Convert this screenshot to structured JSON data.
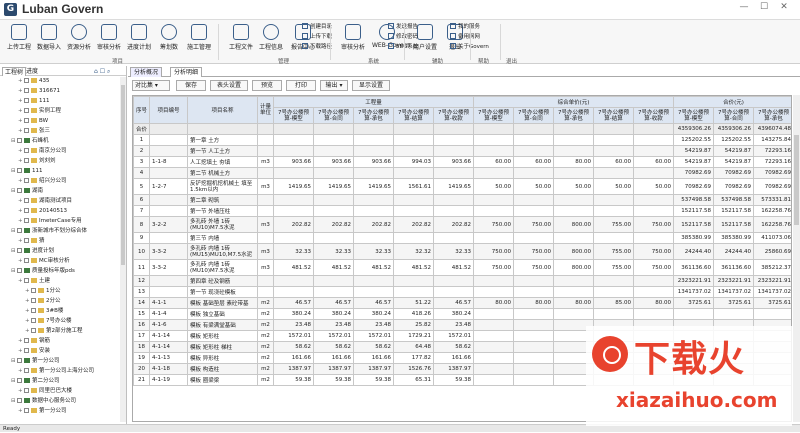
{
  "app": {
    "title": "Luban Govern",
    "logo_letter": "G"
  },
  "ribbon": {
    "buttons": [
      "上传工程",
      "数据导入",
      "资源分析",
      "审核分析",
      "进度计划",
      "筹划数",
      "施工管理",
      "工程文件",
      "工程信息",
      "报告中心",
      "审核分析",
      "WEB-Govern",
      "用户设置",
      "退出"
    ],
    "small": [
      "创建目录",
      "上传下载",
      "下载路径",
      "发送报告",
      "修改密码",
      "EDS系统",
      "我的服务",
      "备用网网",
      "关于Govern"
    ],
    "groups": [
      "项目",
      "管理",
      "系统",
      "辅助",
      "帮助",
      "退出"
    ]
  },
  "left": {
    "tabs": [
      "工程树",
      "进度"
    ],
    "tree": [
      {
        "t": "435",
        "d": 2
      },
      {
        "t": "316671",
        "d": 2
      },
      {
        "t": "111",
        "d": 2
      },
      {
        "t": "实例工程",
        "d": 2
      },
      {
        "t": "BW",
        "d": 2
      },
      {
        "t": "张三",
        "d": 2
      },
      {
        "t": "石峰机",
        "d": 1,
        "g": true
      },
      {
        "t": "南京分公司",
        "d": 2
      },
      {
        "t": "刘刘刘",
        "d": 2
      },
      {
        "t": "111",
        "d": 1,
        "g": true
      },
      {
        "t": "绍兴分公司",
        "d": 2
      },
      {
        "t": "湖南",
        "d": 1,
        "g": true
      },
      {
        "t": "湖南测试项目",
        "d": 2
      },
      {
        "t": "20140513",
        "d": 2
      },
      {
        "t": "ImeterCase专用",
        "d": 2
      },
      {
        "t": "浙新城市不划分综合体",
        "d": 1,
        "g": true
      },
      {
        "t": "猜",
        "d": 2
      },
      {
        "t": "进度计划",
        "d": 1,
        "g": true
      },
      {
        "t": "MC审核分析",
        "d": 2
      },
      {
        "t": "质量投标年版pds",
        "d": 1,
        "g": true
      },
      {
        "t": "土建",
        "d": 2
      },
      {
        "t": "1分公",
        "d": 3
      },
      {
        "t": "2分公",
        "d": 3
      },
      {
        "t": "3#B楼",
        "d": 3
      },
      {
        "t": "7号办公楼",
        "d": 3
      },
      {
        "t": "第2部分施工程",
        "d": 3
      },
      {
        "t": "钢筋",
        "d": 2
      },
      {
        "t": "安装",
        "d": 2
      },
      {
        "t": "第一分公司",
        "d": 1,
        "g": true
      },
      {
        "t": "第一分公司上海分公司",
        "d": 2
      },
      {
        "t": "第二分公司",
        "d": 1,
        "g": true
      },
      {
        "t": "同里巴巴大楼",
        "d": 2
      },
      {
        "t": "数据中心服务公司",
        "d": 1,
        "g": true
      },
      {
        "t": "第一分公司",
        "d": 2
      }
    ]
  },
  "main": {
    "tabs": [
      "分析概况",
      "分析明细"
    ],
    "toolbar": {
      "select": "对比集",
      "buttons": [
        "保存",
        "表头设置",
        "预览",
        "打印",
        "输出",
        "显示设置"
      ]
    },
    "headers": {
      "seq": "序号",
      "code": "项目编号",
      "name": "项目名称",
      "unit": "计量单位",
      "grp_qty": "工程量",
      "grp_price": "综合单价(元)",
      "grp_total": "合价(元)",
      "sub": [
        "7号办公楼预算-模型",
        "7号办公楼预算-合同",
        "7号办公楼预算-承包",
        "7号办公楼预算-结算",
        "7号办公楼预算-收款",
        "7号办公楼预算-模型",
        "7号办公楼预算-合同",
        "7号办公楼预算-承包",
        "7号办公楼预算-结算",
        "7号办公楼预算-收款",
        "7号办公楼预算-模型",
        "7号办公楼预算-合同",
        "7号办公楼预算-承包"
      ]
    },
    "rows": [
      {
        "s": "合价",
        "c": "",
        "n": "",
        "u": "",
        "q": [
          "",
          "",
          "",
          "",
          ""
        ],
        "p": [
          "",
          "",
          "",
          "",
          ""
        ],
        "t": [
          "4359306.26",
          "4359306.26",
          "4396074.48"
        ],
        "g": true
      },
      {
        "s": "1",
        "c": "",
        "n": "第一章 土方",
        "u": "",
        "q": [
          "",
          "",
          "",
          "",
          ""
        ],
        "p": [
          "",
          "",
          "",
          "",
          ""
        ],
        "t": [
          "125202.55",
          "125202.55",
          "143275.84"
        ]
      },
      {
        "s": "2",
        "c": "",
        "n": "第一节 人工土方",
        "u": "",
        "q": [
          "",
          "",
          "",
          "",
          ""
        ],
        "p": [
          "",
          "",
          "",
          "",
          ""
        ],
        "t": [
          "54219.87",
          "54219.87",
          "72293.16"
        ]
      },
      {
        "s": "3",
        "c": "1-1-8",
        "n": "人工挖填土 夯填",
        "u": "m3",
        "q": [
          "903.66",
          "903.66",
          "903.66",
          "994.03",
          "903.66"
        ],
        "p": [
          "60.00",
          "60.00",
          "80.00",
          "60.00",
          "60.00"
        ],
        "t": [
          "54219.87",
          "54219.87",
          "72293.16"
        ]
      },
      {
        "s": "4",
        "c": "",
        "n": "第二节 机械土方",
        "u": "",
        "q": [
          "",
          "",
          "",
          "",
          ""
        ],
        "p": [
          "",
          "",
          "",
          "",
          ""
        ],
        "t": [
          "70982.69",
          "70982.69",
          "70982.69"
        ]
      },
      {
        "s": "5",
        "c": "1-2-7",
        "n": "反铲挖掘机挖机械土 填至1.5km以内",
        "u": "m3",
        "q": [
          "1419.65",
          "1419.65",
          "1419.65",
          "1561.61",
          "1419.65"
        ],
        "p": [
          "50.00",
          "50.00",
          "50.00",
          "50.00",
          "50.00"
        ],
        "t": [
          "70982.69",
          "70982.69",
          "70982.69"
        ]
      },
      {
        "s": "6",
        "c": "",
        "n": "第二章 砌筑",
        "u": "",
        "q": [
          "",
          "",
          "",
          "",
          ""
        ],
        "p": [
          "",
          "",
          "",
          "",
          ""
        ],
        "t": [
          "537498.58",
          "537498.58",
          "573331.81"
        ]
      },
      {
        "s": "7",
        "c": "",
        "n": "第一节 外墙压柱",
        "u": "",
        "q": [
          "",
          "",
          "",
          "",
          ""
        ],
        "p": [
          "",
          "",
          "",
          "",
          ""
        ],
        "t": [
          "152117.58",
          "152117.58",
          "162258.76"
        ]
      },
      {
        "s": "8",
        "c": "3-2-2",
        "n": "多孔砖 外墙 1砖(MU10)M7.5水泥",
        "u": "m3",
        "q": [
          "202.82",
          "202.82",
          "202.82",
          "202.82",
          "202.82"
        ],
        "p": [
          "750.00",
          "750.00",
          "800.00",
          "755.00",
          "750.00"
        ],
        "t": [
          "152117.58",
          "152117.58",
          "162258.76"
        ]
      },
      {
        "s": "9",
        "c": "",
        "n": "第三节 内墙",
        "u": "",
        "q": [
          "",
          "",
          "",
          "",
          ""
        ],
        "p": [
          "",
          "",
          "",
          "",
          ""
        ],
        "t": [
          "385380.99",
          "385380.99",
          "411073.06"
        ]
      },
      {
        "s": "10",
        "c": "3-3-2",
        "n": "多孔砖 内墙 1砖(MU15)MU10,M7.5水泥",
        "u": "m3",
        "q": [
          "32.33",
          "32.33",
          "32.33",
          "32.32",
          "32.33"
        ],
        "p": [
          "750.00",
          "750.00",
          "800.00",
          "755.00",
          "750.00"
        ],
        "t": [
          "24244.40",
          "24244.40",
          "25860.69"
        ]
      },
      {
        "s": "11",
        "c": "3-3-2",
        "n": "多孔砖 内墙 1砖(MU10)M7.5水泥",
        "u": "m3",
        "q": [
          "481.52",
          "481.52",
          "481.52",
          "481.52",
          "481.52"
        ],
        "p": [
          "750.00",
          "750.00",
          "800.00",
          "755.00",
          "750.00"
        ],
        "t": [
          "361136.60",
          "361136.60",
          "385212.37"
        ]
      },
      {
        "s": "12",
        "c": "",
        "n": "第四章 砼及钢筋",
        "u": "",
        "q": [
          "",
          "",
          "",
          "",
          ""
        ],
        "p": [
          "",
          "",
          "",
          "",
          ""
        ],
        "t": [
          "2323221.91",
          "2323221.91",
          "2323221.91"
        ]
      },
      {
        "s": "13",
        "c": "",
        "n": "第一节 现浇砼模板",
        "u": "",
        "q": [
          "",
          "",
          "",
          "",
          ""
        ],
        "p": [
          "",
          "",
          "",
          "",
          ""
        ],
        "t": [
          "1341737.02",
          "1341737.02",
          "1341737.02"
        ]
      },
      {
        "s": "14",
        "c": "4-1-1",
        "n": "模板 基础垫层 素砼带基",
        "u": "m2",
        "q": [
          "46.57",
          "46.57",
          "46.57",
          "51.22",
          "46.57"
        ],
        "p": [
          "80.00",
          "80.00",
          "80.00",
          "85.00",
          "80.00"
        ],
        "t": [
          "3725.61",
          "3725.61",
          "3725.61"
        ]
      },
      {
        "s": "15",
        "c": "4-1-4",
        "n": "模板 独立基础",
        "u": "m2",
        "q": [
          "380.24",
          "380.24",
          "380.24",
          "418.26",
          "380.24"
        ],
        "p": [
          "",
          "",
          "",
          "",
          ""
        ],
        "t": [
          "",
          "",
          ""
        ]
      },
      {
        "s": "16",
        "c": "4-1-6",
        "n": "模板 有梁满堂基础",
        "u": "m2",
        "q": [
          "23.48",
          "23.48",
          "23.48",
          "25.82",
          "23.48"
        ],
        "p": [
          "",
          "",
          "",
          "",
          ""
        ],
        "t": [
          "",
          "",
          ""
        ]
      },
      {
        "s": "17",
        "c": "4-1-14",
        "n": "模板 矩形柱",
        "u": "m2",
        "q": [
          "1572.01",
          "1572.01",
          "1572.01",
          "1729.21",
          "1572.01"
        ],
        "p": [
          "",
          "",
          "",
          "",
          ""
        ],
        "t": [
          "",
          "",
          ""
        ]
      },
      {
        "s": "18",
        "c": "4-1-14",
        "n": "模板 矩形柱 梯柱",
        "u": "m2",
        "q": [
          "58.62",
          "58.62",
          "58.62",
          "64.48",
          "58.62"
        ],
        "p": [
          "",
          "",
          "",
          "",
          ""
        ],
        "t": [
          "",
          "",
          ""
        ]
      },
      {
        "s": "19",
        "c": "4-1-13",
        "n": "模板 异形柱",
        "u": "m2",
        "q": [
          "161.66",
          "161.66",
          "161.66",
          "177.82",
          "161.66"
        ],
        "p": [
          "",
          "",
          "",
          "",
          ""
        ],
        "t": [
          "",
          "",
          ""
        ]
      },
      {
        "s": "20",
        "c": "4-1-18",
        "n": "模板 构造柱",
        "u": "m2",
        "q": [
          "1387.97",
          "1387.97",
          "1387.97",
          "1526.76",
          "1387.97"
        ],
        "p": [
          "",
          "",
          "",
          "",
          ""
        ],
        "t": [
          "",
          "",
          ""
        ]
      },
      {
        "s": "21",
        "c": "4-1-19",
        "n": "模板 圈梁梁",
        "u": "m2",
        "q": [
          "59.38",
          "59.38",
          "59.38",
          "65.31",
          "59.38"
        ],
        "p": [
          "",
          "",
          "",
          "",
          ""
        ],
        "t": [
          "",
          "",
          ""
        ]
      }
    ]
  },
  "status": "Ready",
  "watermark": {
    "big": "下载火",
    "url": "xiazaihuo.com"
  }
}
